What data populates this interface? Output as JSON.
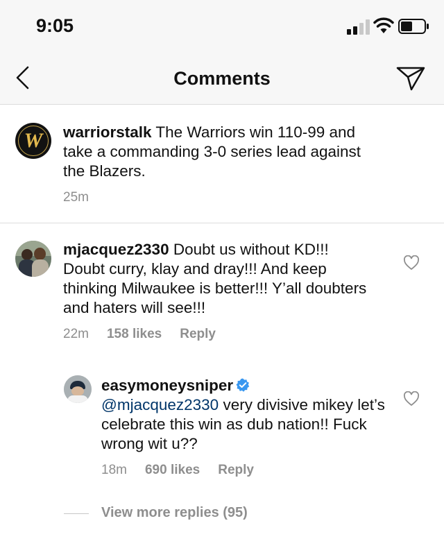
{
  "status_bar": {
    "time": "9:05"
  },
  "nav": {
    "title": "Comments"
  },
  "caption": {
    "username": "warriorstalk",
    "text": " The Warriors win 110-99 and take a commanding 3-0 series lead against the Blazers.",
    "time": "25m",
    "avatar_letter": "W"
  },
  "comments": [
    {
      "username": "mjacquez2330",
      "text": " Doubt us without KD!!! Doubt curry, klay and dray!!! And keep thinking Milwaukee is better!!! Y’all doubters and haters will see!!!",
      "time": "22m",
      "likes": "158 likes",
      "reply": "Reply"
    }
  ],
  "replies": [
    {
      "username": "easymoneysniper",
      "mention": "@mjacquez2330",
      "text": " very divisive mikey let’s celebrate this win as dub nation!! Fuck wrong wit u??",
      "time": "18m",
      "likes": "690 likes",
      "reply": "Reply"
    }
  ],
  "view_more": "View more replies (95)",
  "colors": {
    "verified": "#3897f0",
    "muted": "#8e8e8e",
    "mention": "#003569",
    "gold": "#e3b94e"
  }
}
